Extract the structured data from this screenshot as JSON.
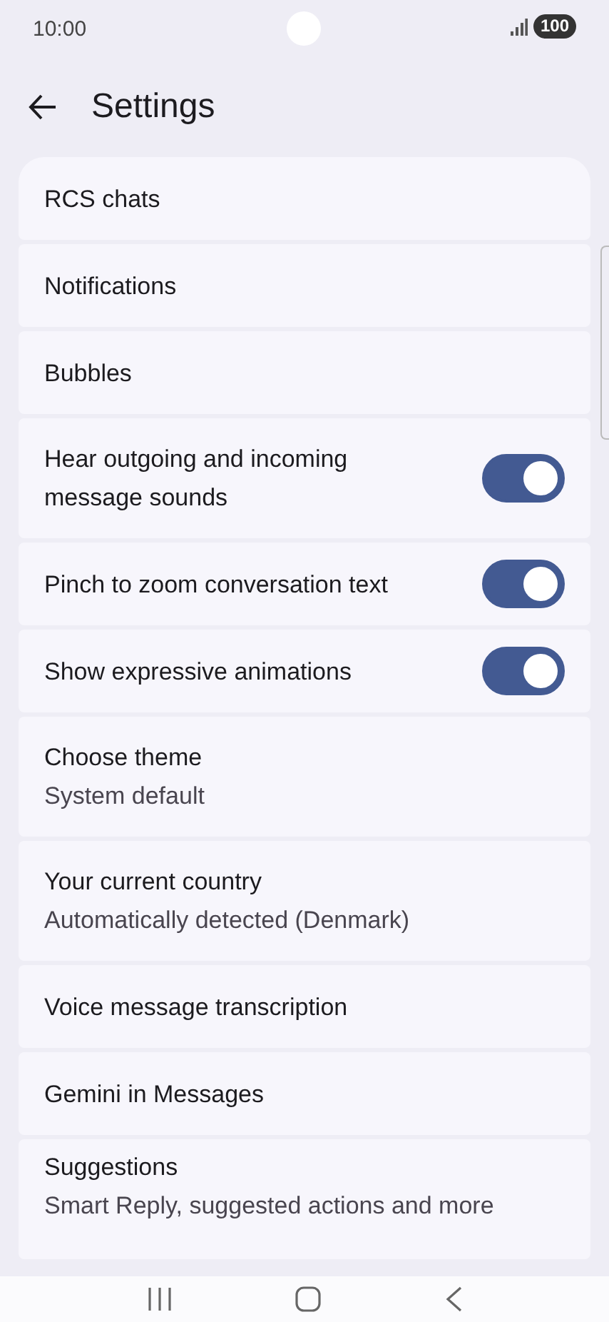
{
  "status_bar": {
    "time": "10:00",
    "battery": "100"
  },
  "header": {
    "title": "Settings"
  },
  "items": [
    {
      "kind": "plain",
      "title": "RCS chats"
    },
    {
      "kind": "plain",
      "title": "Notifications"
    },
    {
      "kind": "plain",
      "title": "Bubbles"
    },
    {
      "kind": "toggle",
      "title": "Hear outgoing and incoming message sounds",
      "on": true
    },
    {
      "kind": "toggle",
      "title": "Pinch to zoom conversation text",
      "on": true
    },
    {
      "kind": "toggle",
      "title": "Show expressive animations",
      "on": true
    },
    {
      "kind": "plain",
      "title": "Choose theme",
      "subtitle": "System default"
    },
    {
      "kind": "plain",
      "title": "Your current country",
      "subtitle": "Automatically detected (Denmark)"
    },
    {
      "kind": "plain",
      "title": "Voice message transcription"
    },
    {
      "kind": "plain",
      "title": "Gemini in Messages"
    },
    {
      "kind": "plain",
      "title": "Suggestions",
      "subtitle": "Smart Reply, suggested actions and more"
    }
  ]
}
